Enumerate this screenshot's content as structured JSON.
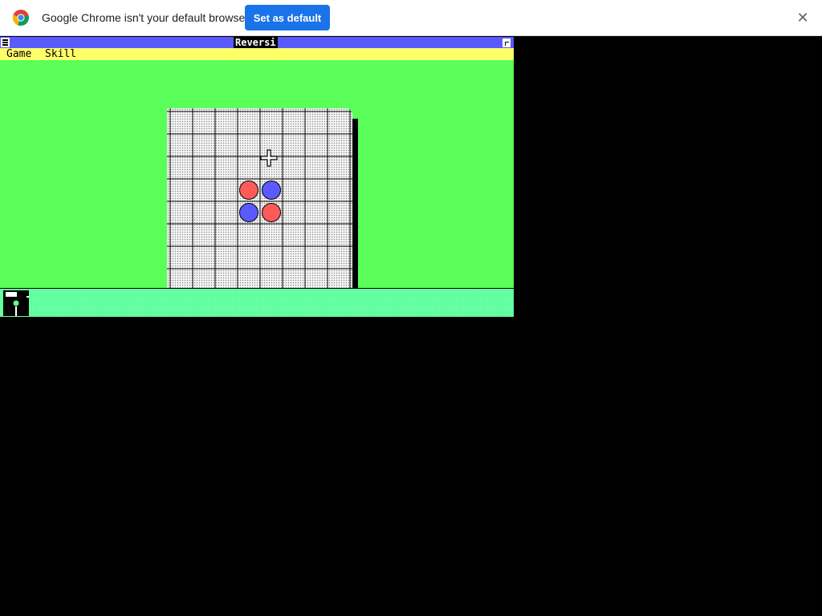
{
  "browser": {
    "infobar": {
      "message": "Google Chrome isn't your default browser",
      "button_label": "Set as default",
      "close_glyph": "✕",
      "icon": "chrome-logo-icon",
      "button_color": "#1a73e8"
    }
  },
  "window": {
    "title": "Reversi",
    "menus": [
      "Game",
      "Skill"
    ],
    "colors": {
      "titlebar": "#5a5aff",
      "menubar": "#ffff6a",
      "client": "#5aff5a",
      "strip": "#5aff9a"
    }
  },
  "board": {
    "size": 8,
    "discs": [
      {
        "row": 3,
        "col": 3,
        "color": "red"
      },
      {
        "row": 3,
        "col": 4,
        "color": "blue"
      },
      {
        "row": 4,
        "col": 3,
        "color": "blue"
      },
      {
        "row": 4,
        "col": 4,
        "color": "red"
      }
    ],
    "piece_colors": {
      "red": "#ff5a5a",
      "blue": "#5a5aff"
    }
  },
  "cursor": {
    "icon": "crosshair-cursor-icon"
  },
  "taskbar": {
    "icons": [
      "reversi-app-icon"
    ]
  }
}
